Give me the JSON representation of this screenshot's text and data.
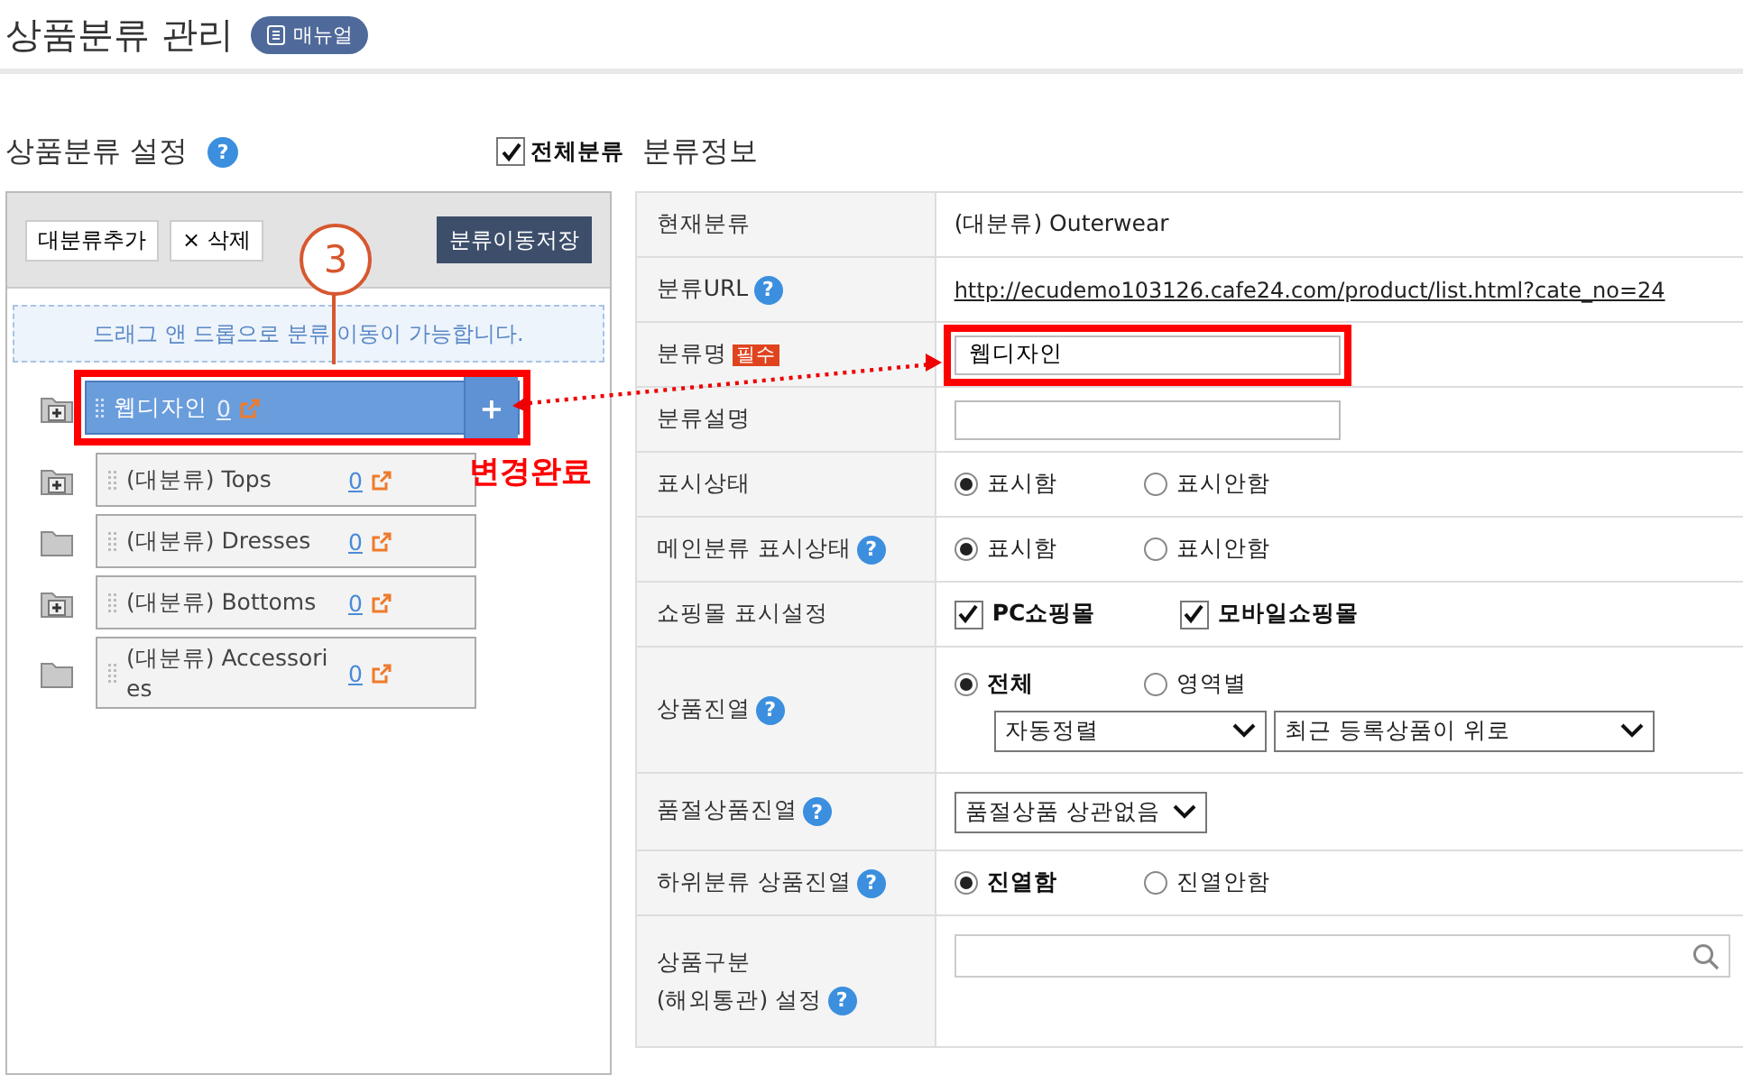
{
  "header": {
    "title": "상품분류 관리",
    "manual_button": "매뉴얼"
  },
  "tree_panel": {
    "title": "상품분류 설정",
    "help": "?",
    "add_button": "대분류추가",
    "delete_button": "× 삭제",
    "save_button": "분류이동저장",
    "hint": "드래그 앤 드롭으로 분류 이동이 가능합니다.",
    "item_action": "+",
    "items": [
      {
        "label": "웹디자인",
        "count": "0",
        "has_children": true,
        "selected": true,
        "highlighted": true
      },
      {
        "label": "(대분류) Tops",
        "count": "0",
        "has_children": true,
        "selected": false,
        "highlighted": false
      },
      {
        "label": "(대분류) Dresses",
        "count": "0",
        "has_children": false,
        "selected": false,
        "highlighted": false
      },
      {
        "label": "(대분류) Bottoms",
        "count": "0",
        "has_children": true,
        "selected": false,
        "highlighted": false
      },
      {
        "label": "(대분류) Accessories",
        "count": "0",
        "has_children": false,
        "selected": false,
        "highlighted": false
      }
    ]
  },
  "show_all": {
    "label": "전체분류",
    "checked": true
  },
  "info_panel": {
    "title": "분류정보",
    "rows": [
      {
        "kind": "text",
        "label": "현재분류",
        "value": "(대분류) Outerwear"
      },
      {
        "kind": "link",
        "label": "분류URL",
        "help": "?",
        "value": "http://ecudemo103126.cafe24.com/product/list.html?cate_no=24"
      },
      {
        "kind": "input",
        "label": "분류명",
        "required": "필수",
        "value": "웹디자인",
        "highlighted": true
      },
      {
        "kind": "input",
        "label": "분류설명",
        "highlighted": false
      },
      {
        "kind": "radio",
        "label": "표시상태",
        "options": [
          {
            "label": "표시함",
            "selected": true,
            "emphasis": false
          },
          {
            "label": "표시안함",
            "selected": false,
            "emphasis": false
          }
        ]
      },
      {
        "kind": "radio",
        "label": "메인분류 표시상태",
        "help": "?",
        "options": [
          {
            "label": "표시함",
            "selected": true,
            "emphasis": false
          },
          {
            "label": "표시안함",
            "selected": false,
            "emphasis": false
          }
        ]
      },
      {
        "kind": "checks",
        "label": "쇼핑몰 표시설정",
        "options": [
          {
            "label": "PC쇼핑몰",
            "checked": true
          },
          {
            "label": "모바일쇼핑몰",
            "checked": true
          }
        ]
      },
      {
        "kind": "radio",
        "label": "상품진열",
        "help": "?",
        "options": [
          {
            "label": "전체",
            "selected": true,
            "emphasis": true
          },
          {
            "label": "영역별",
            "selected": false,
            "emphasis": false
          }
        ],
        "selects": [
          "자동정렬",
          "최근 등록상품이 위로"
        ]
      },
      {
        "kind": "select",
        "label": "품절상품진열",
        "help": "?",
        "selects": [
          "품절상품 상관없음"
        ]
      },
      {
        "kind": "radio",
        "label": "하위분류 상품진열",
        "help": "?",
        "options": [
          {
            "label": "진열함",
            "selected": true,
            "emphasis": true
          },
          {
            "label": "진열안함",
            "selected": false,
            "emphasis": false
          }
        ]
      },
      {
        "kind": "search",
        "label": "상품구분\n(해외통관) 설정",
        "help": "?"
      }
    ]
  },
  "annotations": {
    "step": "3",
    "note": "변경완료"
  }
}
